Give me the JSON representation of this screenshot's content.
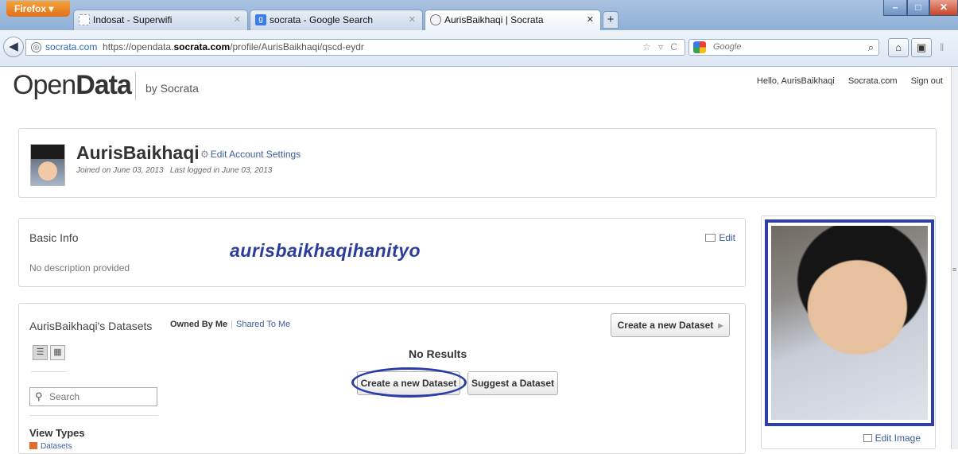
{
  "browser": {
    "firefox_button": "Firefox",
    "tabs": [
      {
        "label": "Indosat - Superwifi"
      },
      {
        "label": "socrata - Google Search"
      },
      {
        "label": "AurisBaikhaqi | Socrata"
      }
    ],
    "new_tab": "+",
    "url": {
      "host_prefix": "socrata.com",
      "scheme": "https://opendata.",
      "domain": "socrata.com",
      "path": "/profile/AurisBaikhaqi/qscd-eydr"
    },
    "search_placeholder": "Google"
  },
  "header": {
    "logo_open": "Open",
    "logo_data": "Data",
    "by": "by Socrata",
    "greeting": "Hello, AurisBaikhaqi",
    "socrata_link": "Socrata.com",
    "sign_out": "Sign out"
  },
  "profile": {
    "name": "AurisBaikhaqi",
    "edit_settings": "Edit Account Settings",
    "joined": "Joined on June 03, 2013",
    "last_logged": "Last logged in June 03, 2013"
  },
  "basic_info": {
    "title": "Basic Info",
    "description": "No description provided",
    "edit": "Edit",
    "watermark": "aurisbaikhaqihanityo"
  },
  "datasets": {
    "title": "AurisBaikhaqi's Datasets",
    "owned": "Owned By Me",
    "shared": "Shared To Me",
    "create_top": "Create a new Dataset",
    "no_results": "No Results",
    "create": "Create a new Dataset",
    "suggest": "Suggest a Dataset",
    "search_placeholder": "Search",
    "view_types": "View Types",
    "view_datasets": "Datasets"
  },
  "image_panel": {
    "edit_image": "Edit Image"
  }
}
